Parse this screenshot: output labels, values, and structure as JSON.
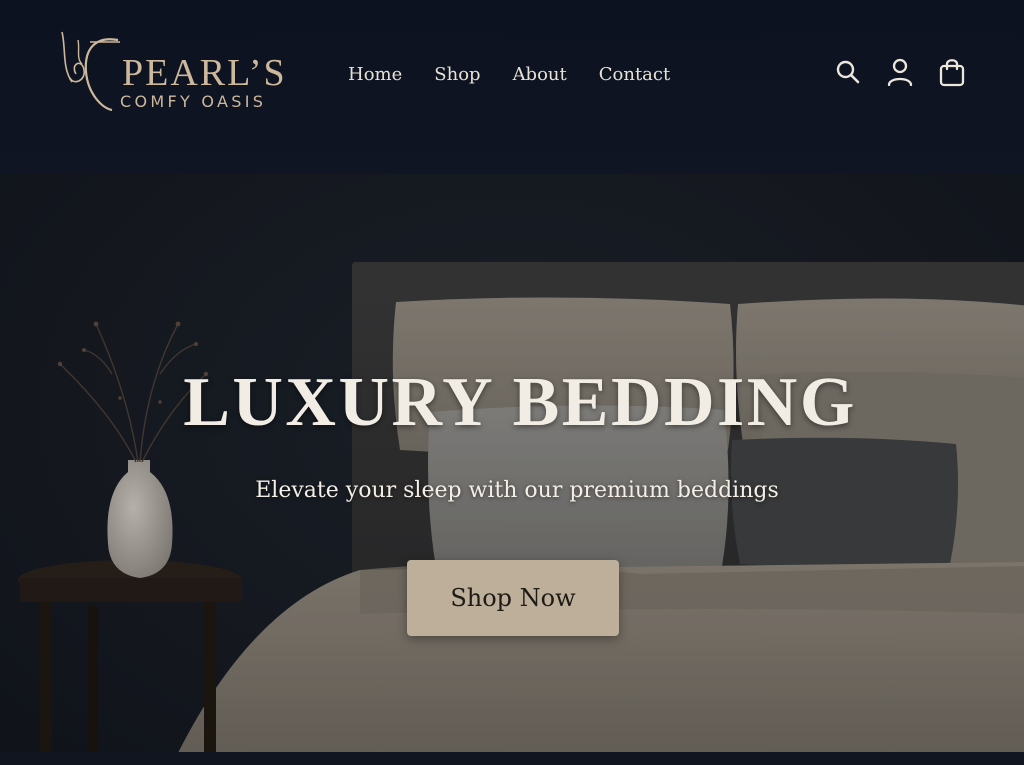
{
  "brand": {
    "name": "PEARL’S",
    "tagline": "COMFY OASIS",
    "accent_color": "#cdb89c"
  },
  "nav": {
    "items": [
      {
        "label": "Home"
      },
      {
        "label": "Shop"
      },
      {
        "label": "About"
      },
      {
        "label": "Contact"
      }
    ]
  },
  "header_icons": [
    "search-icon",
    "user-account-icon",
    "shopping-bag-icon"
  ],
  "hero": {
    "title": "LUXURY BEDDING",
    "subtitle": "Elevate your sleep with our premium beddings",
    "cta_label": "Shop Now",
    "cta_color": "#bdaf9a"
  }
}
